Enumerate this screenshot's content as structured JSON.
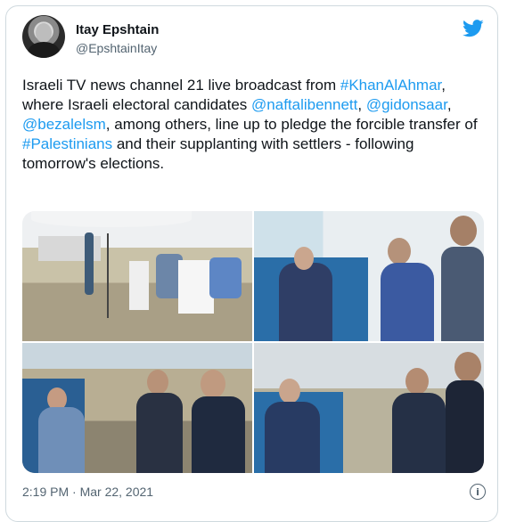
{
  "author": {
    "name": "Itay Epshtain",
    "handle": "@EpshtainItay"
  },
  "tweet": {
    "text_1": "Israeli TV news channel 21 live broadcast from ",
    "hashtag_1": "#KhanAlAhmar",
    "text_2": ", where Israeli electoral candidates ",
    "mention_1": "@naftalibennett",
    "sep_1": ", ",
    "mention_2": "@gidonsaar",
    "sep_2": ", ",
    "mention_3": "@bezalelsm",
    "text_3": ", among others, line up to pledge the forcible transfer of ",
    "hashtag_2": "#Palestinians",
    "text_4": " and their supplanting with settlers - following tomorrow's elections."
  },
  "timestamp": "2:19 PM · Mar 22, 2021",
  "icons": {
    "brand": "twitter-bird-icon",
    "info": "info-icon"
  },
  "colors": {
    "link": "#1d9bf0",
    "text": "#0f1419",
    "muted": "#536471",
    "border": "#cfd9de"
  },
  "media": {
    "count": 4
  }
}
